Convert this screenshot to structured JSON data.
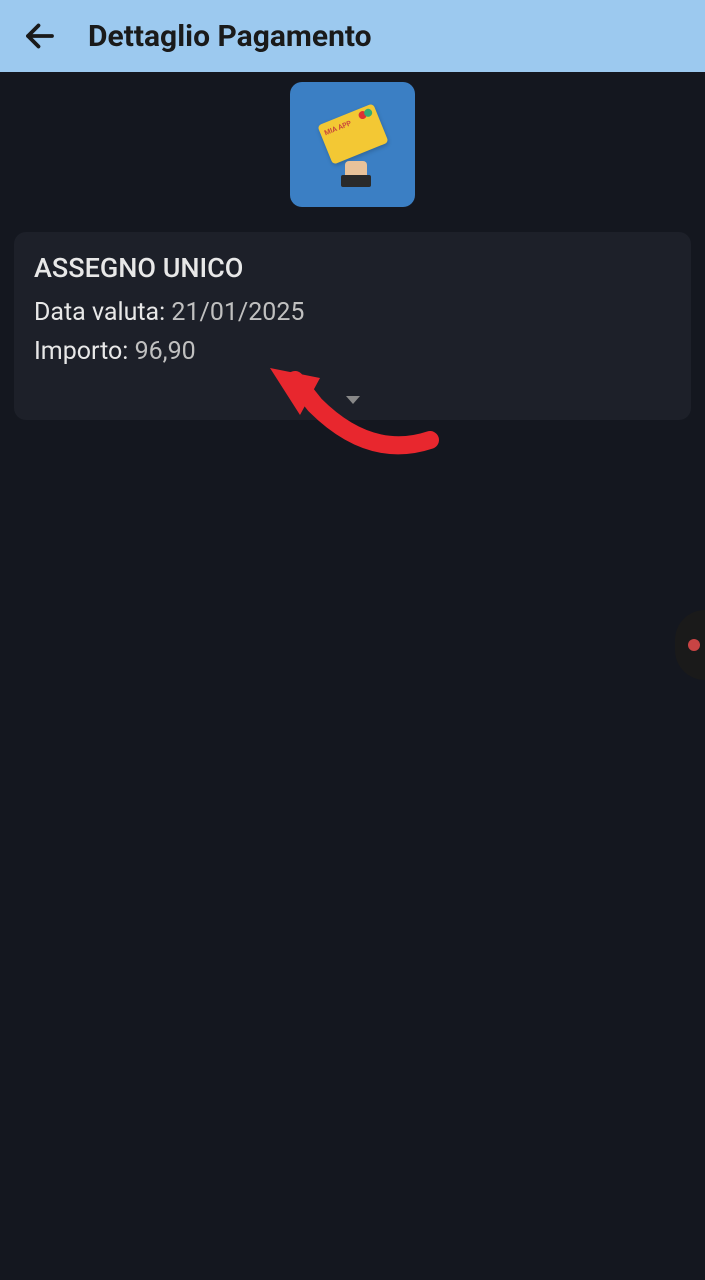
{
  "header": {
    "title": "Dettaglio Pagamento"
  },
  "logo": {
    "card_text": "MIA APP"
  },
  "payment": {
    "title": "ASSEGNO UNICO",
    "date_label": "Data valuta:",
    "date_value": "21/01/2025",
    "amount_label": "Importo:",
    "amount_value": "96,90"
  }
}
